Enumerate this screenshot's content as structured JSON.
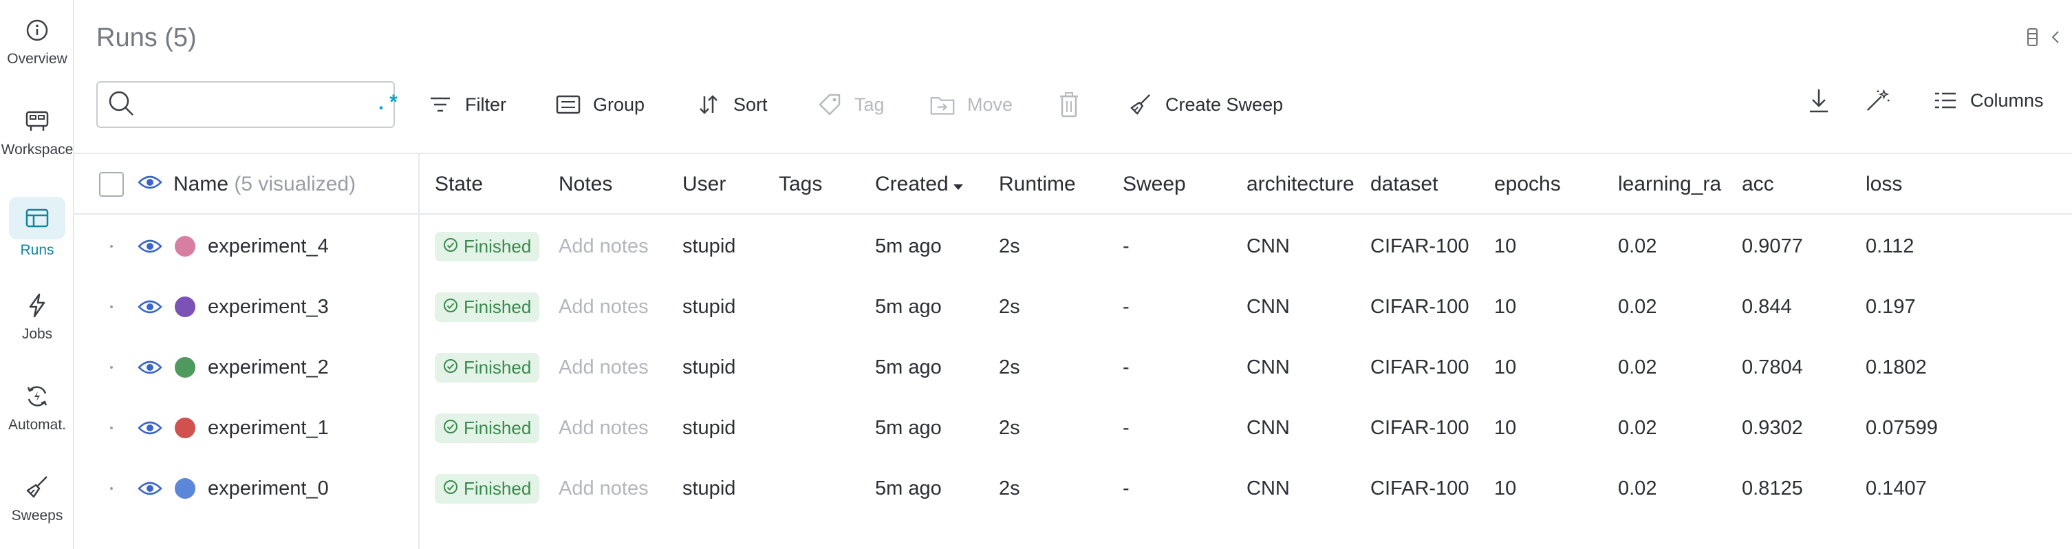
{
  "nav": {
    "items": [
      {
        "label": "Overview",
        "icon": "info-icon"
      },
      {
        "label": "Workspace",
        "icon": "workspace-icon"
      },
      {
        "label": "Runs",
        "icon": "runs-table-icon"
      },
      {
        "label": "Jobs",
        "icon": "lightning-icon"
      },
      {
        "label": "Automat.",
        "icon": "automation-icon"
      },
      {
        "label": "Sweeps",
        "icon": "broom-icon"
      }
    ],
    "active": "Runs"
  },
  "header": {
    "title": "Runs (5)"
  },
  "search": {
    "value": "",
    "placeholder": "",
    "regex_label": ".*"
  },
  "toolbar": {
    "filter": "Filter",
    "group": "Group",
    "sort": "Sort",
    "tag": "Tag",
    "move": "Move",
    "create_sweep": "Create Sweep",
    "columns": "Columns"
  },
  "table": {
    "columns": {
      "name": "Name",
      "name_suffix": "(5 visualized)",
      "state": "State",
      "notes": "Notes",
      "user": "User",
      "tags": "Tags",
      "created": "Created",
      "runtime": "Runtime",
      "sweep": "Sweep",
      "architecture": "architecture",
      "dataset": "dataset",
      "epochs": "epochs",
      "learning_rate": "learning_ra",
      "acc": "acc",
      "loss": "loss"
    },
    "rows": [
      {
        "name": "experiment_4",
        "color": "#d77fa2",
        "state": "Finished",
        "notes": "Add notes",
        "user": "stupid",
        "tags": "",
        "created": "5m ago",
        "runtime": "2s",
        "sweep": "-",
        "architecture": "CNN",
        "dataset": "CIFAR-100",
        "epochs": "10",
        "learning_rate": "0.02",
        "acc": "0.9077",
        "loss": "0.112"
      },
      {
        "name": "experiment_3",
        "color": "#7b52b5",
        "state": "Finished",
        "notes": "Add notes",
        "user": "stupid",
        "tags": "",
        "created": "5m ago",
        "runtime": "2s",
        "sweep": "-",
        "architecture": "CNN",
        "dataset": "CIFAR-100",
        "epochs": "10",
        "learning_rate": "0.02",
        "acc": "0.844",
        "loss": "0.197"
      },
      {
        "name": "experiment_2",
        "color": "#4e9a5e",
        "state": "Finished",
        "notes": "Add notes",
        "user": "stupid",
        "tags": "",
        "created": "5m ago",
        "runtime": "2s",
        "sweep": "-",
        "architecture": "CNN",
        "dataset": "CIFAR-100",
        "epochs": "10",
        "learning_rate": "0.02",
        "acc": "0.7804",
        "loss": "0.1802"
      },
      {
        "name": "experiment_1",
        "color": "#d1514f",
        "state": "Finished",
        "notes": "Add notes",
        "user": "stupid",
        "tags": "",
        "created": "5m ago",
        "runtime": "2s",
        "sweep": "-",
        "architecture": "CNN",
        "dataset": "CIFAR-100",
        "epochs": "10",
        "learning_rate": "0.02",
        "acc": "0.9302",
        "loss": "0.07599"
      },
      {
        "name": "experiment_0",
        "color": "#5b86da",
        "state": "Finished",
        "notes": "Add notes",
        "user": "stupid",
        "tags": "",
        "created": "5m ago",
        "runtime": "2s",
        "sweep": "-",
        "architecture": "CNN",
        "dataset": "CIFAR-100",
        "epochs": "10",
        "learning_rate": "0.02",
        "acc": "0.8125",
        "loss": "0.1407"
      }
    ]
  }
}
